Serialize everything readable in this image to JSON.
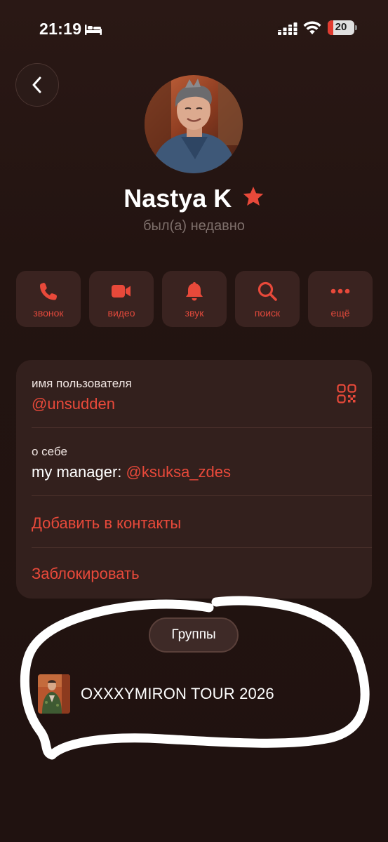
{
  "status_bar": {
    "time": "21:19",
    "battery_level": "20",
    "battery_fraction": 0.2
  },
  "header": {
    "back_icon": "chevron-left-icon"
  },
  "profile": {
    "name": "Nastya K",
    "star_icon": "star-icon",
    "last_seen": "был(а) недавно"
  },
  "actions": [
    {
      "label": "звонок",
      "icon": "phone-icon"
    },
    {
      "label": "видео",
      "icon": "video-camera-icon"
    },
    {
      "label": "звук",
      "icon": "bell-icon"
    },
    {
      "label": "поиск",
      "icon": "search-icon"
    },
    {
      "label": "ещё",
      "icon": "more-icon"
    }
  ],
  "info": {
    "username_caption": "имя пользователя",
    "username_value": "@unsudden",
    "bio_caption": "о себе",
    "bio_prefix": "my manager: ",
    "bio_mention": "@ksuksa_zdes",
    "add_contact": "Добавить в контакты",
    "block": "Заблокировать"
  },
  "groups": {
    "chip_label": "Группы",
    "items": [
      {
        "name": "OXXXYMIRON TOUR 2026"
      }
    ]
  },
  "colors": {
    "background": "#221411",
    "card": "#33201d",
    "accent": "#e8493a",
    "text": "#ffffff",
    "muted": "#7e6f6b"
  }
}
